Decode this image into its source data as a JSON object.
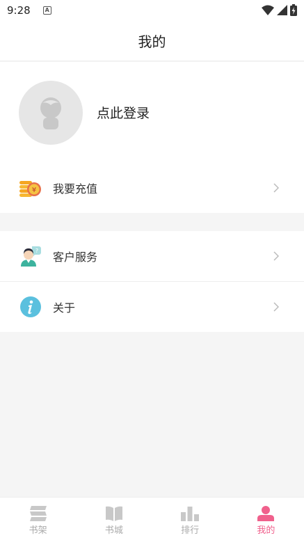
{
  "status": {
    "time": "9:28",
    "app_badge": "A"
  },
  "header": {
    "title": "我的"
  },
  "profile": {
    "login_label": "点此登录"
  },
  "menu": {
    "recharge": "我要充值",
    "recharge_coin_symbol": "¥",
    "service": "客户服务",
    "about": "关于"
  },
  "tabs": [
    {
      "label": "书架",
      "icon": "bookshelf-icon",
      "active": false
    },
    {
      "label": "书城",
      "icon": "open-book-icon",
      "active": false
    },
    {
      "label": "排行",
      "icon": "ranking-bars-icon",
      "active": false
    },
    {
      "label": "我的",
      "icon": "person-icon",
      "active": true
    }
  ],
  "colors": {
    "accent": "#f0608c",
    "inactive": "#aaaaaa",
    "background": "#f5f5f5",
    "about_icon": "#5bc0de",
    "coin": "#f5a623"
  }
}
